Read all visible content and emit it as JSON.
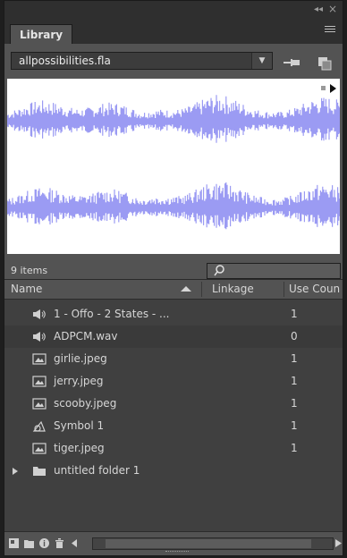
{
  "window": {
    "collapse_label": "◂◂",
    "close_label": "×"
  },
  "tabs": [
    {
      "label": "Library"
    }
  ],
  "document_select": {
    "value": "allpossibilities.fla"
  },
  "counts": {
    "items_label": "9 items"
  },
  "table": {
    "columns": [
      "Name",
      "Linkage",
      "Use Coun"
    ]
  },
  "items": [
    {
      "name": "1 - Offo - 2 States - ...",
      "icon": "sound-icon",
      "use_count": "1",
      "selected": false
    },
    {
      "name": "ADPCM.wav",
      "icon": "sound-icon",
      "use_count": "0",
      "selected": true
    },
    {
      "name": "girlie.jpeg",
      "icon": "bitmap-icon",
      "use_count": "1",
      "selected": false
    },
    {
      "name": "jerry.jpeg",
      "icon": "bitmap-icon",
      "use_count": "1",
      "selected": false
    },
    {
      "name": "scooby.jpeg",
      "icon": "bitmap-icon",
      "use_count": "1",
      "selected": false
    },
    {
      "name": "Symbol 1",
      "icon": "graphic-symbol-icon",
      "use_count": "1",
      "selected": false
    },
    {
      "name": "tiger.jpeg",
      "icon": "bitmap-icon",
      "use_count": "1",
      "selected": false
    },
    {
      "name": "untitled folder 1",
      "icon": "folder-icon",
      "use_count": "",
      "selected": false
    }
  ],
  "colors": {
    "waveform": "#9b9bf3",
    "panel_bg": "#535353",
    "list_bg": "#404040"
  }
}
